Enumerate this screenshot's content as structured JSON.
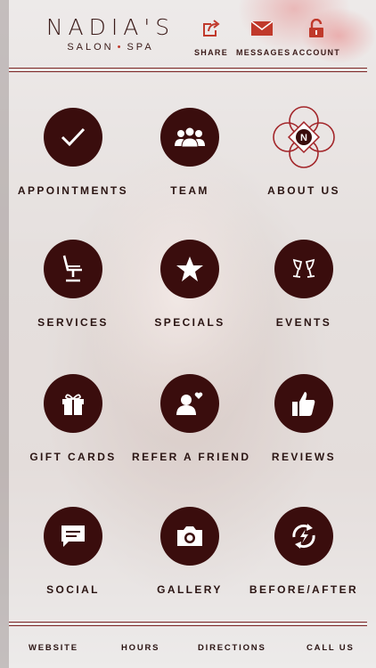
{
  "brand": {
    "name": "NADIA'S",
    "sub_left": "SALON",
    "sub_dot": "•",
    "sub_right": "SPA"
  },
  "header_actions": [
    {
      "label": "SHARE",
      "icon": "share-icon"
    },
    {
      "label": "MESSAGES",
      "icon": "envelope-icon"
    },
    {
      "label": "ACCOUNT",
      "icon": "lock-icon"
    }
  ],
  "tiles": [
    {
      "label": "APPOINTMENTS",
      "icon": "checkmark-icon"
    },
    {
      "label": "TEAM",
      "icon": "team-icon"
    },
    {
      "label": "ABOUT US",
      "icon": "logo-emblem-icon",
      "emblem_letter": "N"
    },
    {
      "label": "SERVICES",
      "icon": "salon-chair-icon"
    },
    {
      "label": "SPECIALS",
      "icon": "star-icon"
    },
    {
      "label": "EVENTS",
      "icon": "champagne-icon"
    },
    {
      "label": "GIFT CARDS",
      "icon": "gift-icon"
    },
    {
      "label": "REFER A FRIEND",
      "icon": "refer-friend-icon"
    },
    {
      "label": "REVIEWS",
      "icon": "thumbs-up-icon"
    },
    {
      "label": "SOCIAL",
      "icon": "chat-bubble-icon"
    },
    {
      "label": "GALLERY",
      "icon": "camera-icon"
    },
    {
      "label": "BEFORE/AFTER",
      "icon": "before-after-icon"
    }
  ],
  "footer": [
    {
      "label": "WEBSITE"
    },
    {
      "label": "HOURS"
    },
    {
      "label": "DIRECTIONS"
    },
    {
      "label": "CALL US"
    }
  ],
  "colors": {
    "accent": "#3a0d0d",
    "brand_red": "#c0392b",
    "text": "#2a1412"
  }
}
